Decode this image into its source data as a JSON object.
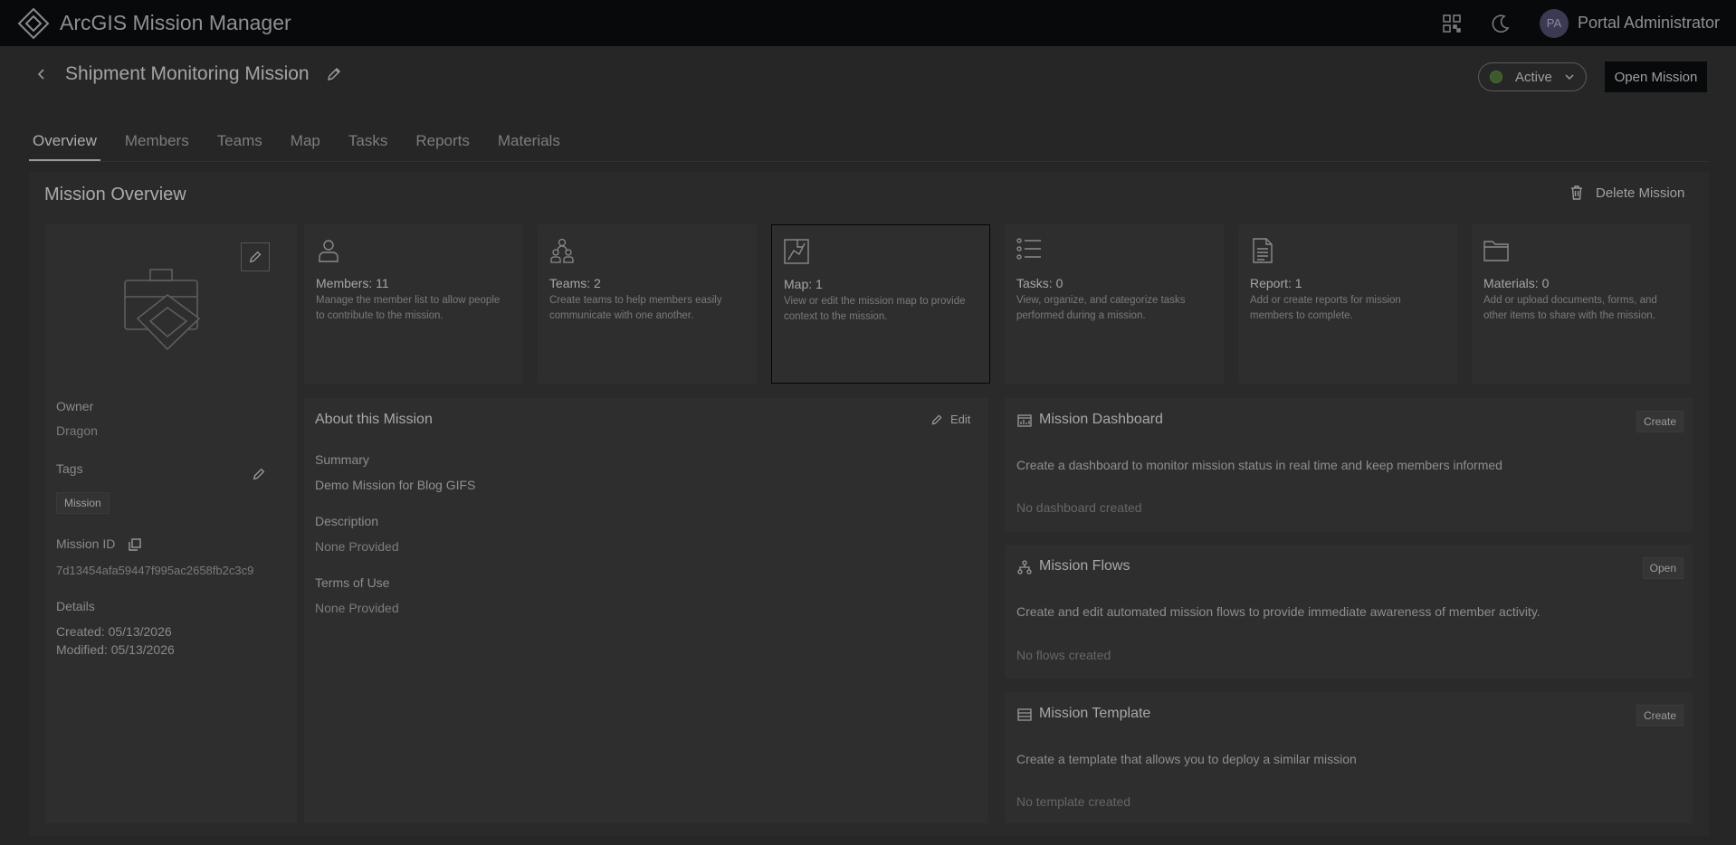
{
  "header": {
    "app_title": "ArcGIS Mission Manager",
    "qr_icon": "qr-code-icon",
    "theme_icon": "moon-icon",
    "avatar_initials": "PA",
    "user_name": "Portal Administrator"
  },
  "mission": {
    "title": "Shipment Monitoring Mission",
    "status": "Active",
    "open_label": "Open Mission"
  },
  "tabs": [
    {
      "label": "Overview"
    },
    {
      "label": "Members"
    },
    {
      "label": "Teams"
    },
    {
      "label": "Map"
    },
    {
      "label": "Tasks"
    },
    {
      "label": "Reports"
    },
    {
      "label": "Materials"
    }
  ],
  "overview": {
    "title": "Mission Overview",
    "delete_label": "Delete Mission"
  },
  "info": {
    "owner_label": "Owner",
    "owner_value": "Dragon",
    "tags_label": "Tags",
    "tag": "Mission",
    "mission_id_label": "Mission ID",
    "mission_id_value": "7d13454afa59447f995ac2658fb2c3c9",
    "details_label": "Details",
    "created": "Created: 05/13/2026",
    "modified": "Modified: 05/13/2026"
  },
  "cards": [
    {
      "title": "Members: 11",
      "desc": "Manage the member list to allow people to contribute to the mission."
    },
    {
      "title": "Teams: 2",
      "desc": "Create teams to help members easily communicate with one another."
    },
    {
      "title": "Map: 1",
      "desc": "View or edit the mission map to provide context to the mission."
    },
    {
      "title": "Tasks: 0",
      "desc": "View, organize, and categorize tasks performed during a mission."
    },
    {
      "title": "Report: 1",
      "desc": "Add or create reports for mission members to complete."
    },
    {
      "title": "Materials: 0",
      "desc": "Add or upload documents, forms, and other items to share with the mission."
    }
  ],
  "about": {
    "title": "About this Mission",
    "edit_label": "Edit",
    "summary_label": "Summary",
    "summary_value": "Demo Mission for Blog GIFS",
    "description_label": "Description",
    "description_value": "None Provided",
    "terms_label": "Terms of Use",
    "terms_value": "None Provided"
  },
  "dashboard": {
    "title": "Mission Dashboard",
    "button": "Create",
    "desc": "Create a dashboard to monitor mission status in real time and keep members informed",
    "empty": "No dashboard created"
  },
  "flows": {
    "title": "Mission Flows",
    "button": "Open",
    "desc": "Create and edit automated mission flows to provide immediate awareness of member activity.",
    "empty": "No flows created"
  },
  "template": {
    "title": "Mission Template",
    "button": "Create",
    "desc": "Create a template that allows you to deploy a similar mission",
    "empty": "No template created"
  }
}
